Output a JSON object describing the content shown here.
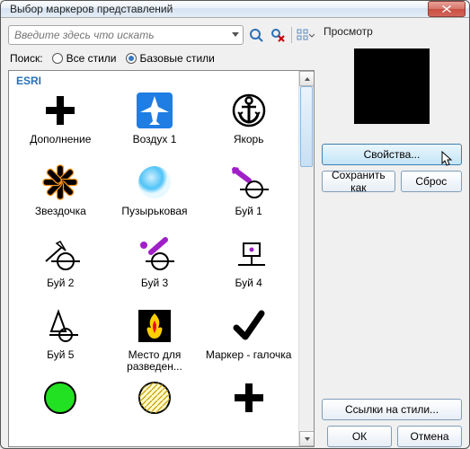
{
  "window": {
    "title": "Выбор маркеров представлений"
  },
  "search": {
    "placeholder": "Введите здесь что искать",
    "label": "Поиск:",
    "radio_all": "Все стили",
    "radio_ref": "Базовые стили"
  },
  "group_header": "ESRI",
  "items": [
    {
      "name": "Дополнение",
      "icon": "plus-black"
    },
    {
      "name": "Воздух 1",
      "icon": "airplane"
    },
    {
      "name": "Якорь",
      "icon": "anchor"
    },
    {
      "name": "Звездочка",
      "icon": "asterisk"
    },
    {
      "name": "Пузырьковая",
      "icon": "bubble"
    },
    {
      "name": "Буй 1",
      "icon": "buoy1"
    },
    {
      "name": "Буй 2",
      "icon": "buoy2"
    },
    {
      "name": "Буй 3",
      "icon": "buoy3"
    },
    {
      "name": "Буй 4",
      "icon": "buoy4"
    },
    {
      "name": "Буй 5",
      "icon": "buoy5"
    },
    {
      "name": "Место для разведен...",
      "icon": "campfire"
    },
    {
      "name": "Маркер - галочка",
      "icon": "checkmark"
    },
    {
      "name": "",
      "icon": "circle-green"
    },
    {
      "name": "",
      "icon": "circle-hatch"
    },
    {
      "name": "",
      "icon": "plus-black2"
    }
  ],
  "preview": {
    "label": "Просмотр",
    "props_btn": "Свойства...",
    "saveas_btn": "Сохранить как",
    "reset_btn": "Сброс",
    "styleref_btn": "Ссылки на стили...",
    "ok_btn": "ОК",
    "cancel_btn": "Отмена"
  }
}
